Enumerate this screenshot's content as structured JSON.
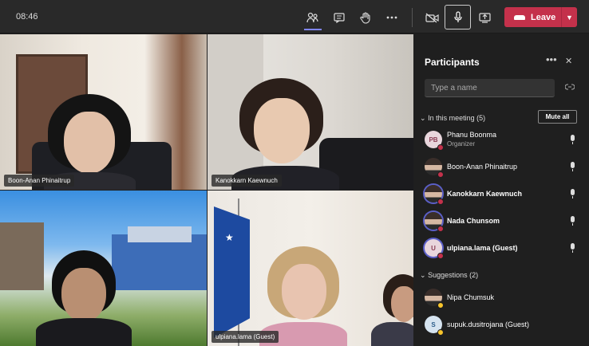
{
  "topbar": {
    "time": "08:46",
    "leave_label": "Leave",
    "icons": [
      "people-icon",
      "chat-icon",
      "raise-hand-icon",
      "more-icon",
      "camera-off-icon",
      "microphone-icon",
      "share-screen-icon",
      "phone-icon",
      "chevron-down-icon"
    ]
  },
  "colors": {
    "leave": "#c4314b",
    "accent": "#7f85f5",
    "panel_bg": "#1f1f1f",
    "bar_bg": "#292929"
  },
  "videos": [
    {
      "name": "Boon-Anan Phinaitrup"
    },
    {
      "name": "Kanokkarn Kaewnuch"
    },
    {
      "name": ""
    },
    {
      "name": "ulpiana.lama (Guest)"
    }
  ],
  "panel": {
    "title": "Participants",
    "search_placeholder": "Type a name",
    "in_meeting_label": "In this meeting (5)",
    "mute_all_label": "Mute all",
    "suggestions_label": "Suggestions (2)",
    "participants": [
      {
        "initials": "PB",
        "name": "Phanu Boonma",
        "role": "Organizer",
        "bold": false
      },
      {
        "initials": "",
        "name": "Boon-Anan Phinaitrup",
        "role": "",
        "bold": false
      },
      {
        "initials": "",
        "name": "Kanokkarn Kaewnuch",
        "role": "",
        "bold": true
      },
      {
        "initials": "",
        "name": "Nada Chunsom",
        "role": "",
        "bold": true
      },
      {
        "initials": "U",
        "name": "ulpiana.lama (Guest)",
        "role": "",
        "bold": true
      }
    ],
    "suggestions": [
      {
        "initials": "",
        "name": "Nipa Chumsuk"
      },
      {
        "initials": "S",
        "name": "supuk.dusitrojana (Guest)"
      }
    ]
  }
}
